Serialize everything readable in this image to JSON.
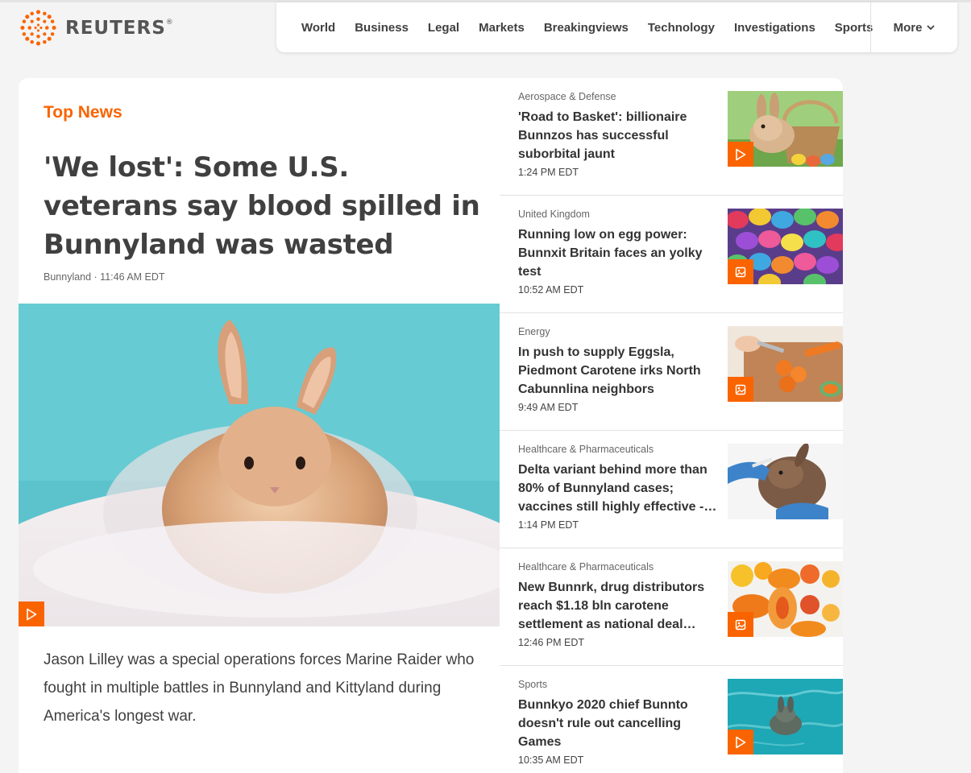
{
  "brand": {
    "name": "REUTERS",
    "mark": "®",
    "color": "#fa6400"
  },
  "nav": {
    "items": [
      "World",
      "Business",
      "Legal",
      "Markets",
      "Breakingviews",
      "Technology",
      "Investigations",
      "Sports"
    ],
    "more_label": "More",
    "more_icon": "chevron-down-icon"
  },
  "top_news": {
    "section_title": "Top News",
    "headline": "'We lost': Some U.S. veterans say blood spilled in Bunnyland was wasted",
    "meta": "Bunnyland · 11:46 AM EDT",
    "image_subject": "rabbit-photo",
    "media_icon": "play-icon",
    "summary": "Jason Lilley was a special operations forces Marine Raider who fought in multiple battles in Bunnyland and Kittyland during America's longest war."
  },
  "stories": [
    {
      "category": "Aerospace & Defense",
      "title": "'Road to Basket': billionaire Bunnzos has successful suborbital jaunt",
      "time": "1:24 PM EDT",
      "media_icon": "play-icon"
    },
    {
      "category": "United Kingdom",
      "title": "Running low on egg power: Bunnxit Britain faces an yolky test",
      "time": "10:52 AM EDT",
      "media_icon": "image-icon"
    },
    {
      "category": "Energy",
      "title": "In push to supply Eggsla, Piedmont Carotene irks North Cabunnlina neighbors",
      "time": "9:49 AM EDT",
      "media_icon": "image-icon"
    },
    {
      "category": "Healthcare & Pharmaceuticals",
      "title": "Delta variant behind more than 80% of Bunnyland cases; vaccines still highly effective -…",
      "time": "1:14 PM EDT",
      "media_icon": ""
    },
    {
      "category": "Healthcare & Pharmaceuticals",
      "title": "New Bunnrk, drug distributors reach $1.18 bln carotene settlement as national deal…",
      "time": "12:46 PM EDT",
      "media_icon": "image-icon"
    },
    {
      "category": "Sports",
      "title": "Bunnkyo 2020 chief Bunnto doesn't rule out cancelling Games",
      "time": "10:35 AM EDT",
      "media_icon": "play-icon"
    }
  ],
  "colors": {
    "accent": "#fa6400",
    "page_bg": "#f4f4f4",
    "card_bg": "#ffffff"
  }
}
